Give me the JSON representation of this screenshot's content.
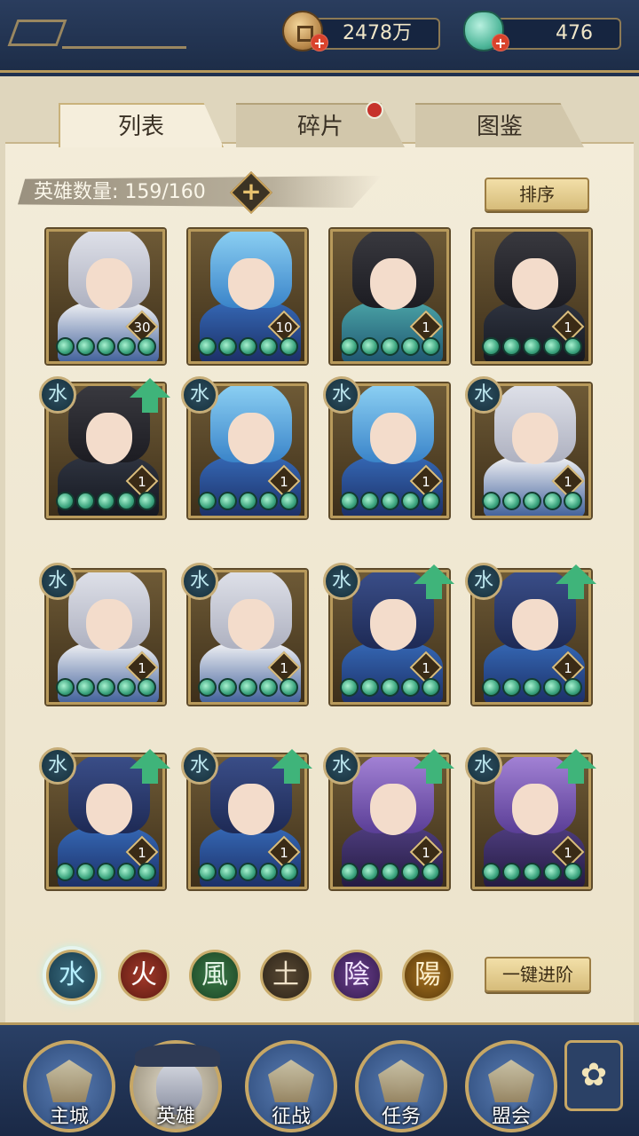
{
  "resources": {
    "coins": "2478万",
    "gems": "476"
  },
  "tabs": [
    {
      "label": "列表",
      "active": true
    },
    {
      "label": "碎片",
      "active": false,
      "has_notice": true
    },
    {
      "label": "图鉴",
      "active": false
    }
  ],
  "hero_count": "英雄数量: 159/160",
  "sort_label": "排序",
  "advance_label": "一键进阶",
  "heroes": [
    {
      "hair": "silver",
      "body": "white",
      "level": "30",
      "stars": 5,
      "element_badge": false,
      "upgradable": false
    },
    {
      "hair": "blue",
      "body": "blue",
      "level": "10",
      "stars": 5,
      "element_badge": false,
      "upgradable": false
    },
    {
      "hair": "black",
      "body": "teal",
      "level": "1",
      "stars": 5,
      "element_badge": false,
      "upgradable": false
    },
    {
      "hair": "black",
      "body": "dark",
      "level": "1",
      "stars": 5,
      "element_badge": false,
      "upgradable": false
    },
    {
      "hair": "black",
      "body": "dark",
      "level": "1",
      "stars": 5,
      "element_badge": true,
      "upgradable": true
    },
    {
      "hair": "blue",
      "body": "blue",
      "level": "1",
      "stars": 5,
      "element_badge": true,
      "upgradable": false
    },
    {
      "hair": "blue",
      "body": "blue",
      "level": "1",
      "stars": 5,
      "element_badge": true,
      "upgradable": false
    },
    {
      "hair": "silver",
      "body": "white",
      "level": "1",
      "stars": 5,
      "element_badge": true,
      "upgradable": false
    },
    {
      "hair": "silver",
      "body": "white",
      "level": "1",
      "stars": 5,
      "element_badge": true,
      "upgradable": false
    },
    {
      "hair": "silver",
      "body": "white",
      "level": "1",
      "stars": 5,
      "element_badge": true,
      "upgradable": false
    },
    {
      "hair": "lotus",
      "body": "blue",
      "level": "1",
      "stars": 5,
      "element_badge": true,
      "upgradable": true
    },
    {
      "hair": "lotus",
      "body": "blue",
      "level": "1",
      "stars": 5,
      "element_badge": true,
      "upgradable": true
    },
    {
      "hair": "lotus",
      "body": "blue",
      "level": "1",
      "stars": 5,
      "element_badge": true,
      "upgradable": true
    },
    {
      "hair": "lotus",
      "body": "blue",
      "level": "1",
      "stars": 5,
      "element_badge": true,
      "upgradable": true
    },
    {
      "hair": "purple",
      "body": "purple",
      "level": "1",
      "stars": 5,
      "element_badge": true,
      "upgradable": true
    },
    {
      "hair": "purple",
      "body": "purple",
      "level": "1",
      "stars": 5,
      "element_badge": true,
      "upgradable": true
    }
  ],
  "element_badge_glyph": "水",
  "elements": [
    {
      "key": "water",
      "glyph": "水",
      "selected": true
    },
    {
      "key": "fire",
      "glyph": "火",
      "selected": false
    },
    {
      "key": "wind",
      "glyph": "風",
      "selected": false
    },
    {
      "key": "earth",
      "glyph": "土",
      "selected": false
    },
    {
      "key": "yin",
      "glyph": "陰",
      "selected": false
    },
    {
      "key": "yang",
      "glyph": "陽",
      "selected": false
    }
  ],
  "nav": [
    {
      "label": "主城",
      "icon": "city-gate-icon",
      "active": false
    },
    {
      "label": "英雄",
      "icon": "hero-portrait-icon",
      "active": true
    },
    {
      "label": "征战",
      "icon": "war-drum-icon",
      "active": false
    },
    {
      "label": "任务",
      "icon": "scroll-icon",
      "active": false
    },
    {
      "label": "盟会",
      "icon": "guild-pavilion-icon",
      "active": false
    }
  ],
  "menu_glyph": "✿",
  "colors": {
    "accent_gold": "#c9ac6c",
    "nav_blue": "#2a4066",
    "star_green": "#3aa37d",
    "notice_red": "#c6322b"
  }
}
